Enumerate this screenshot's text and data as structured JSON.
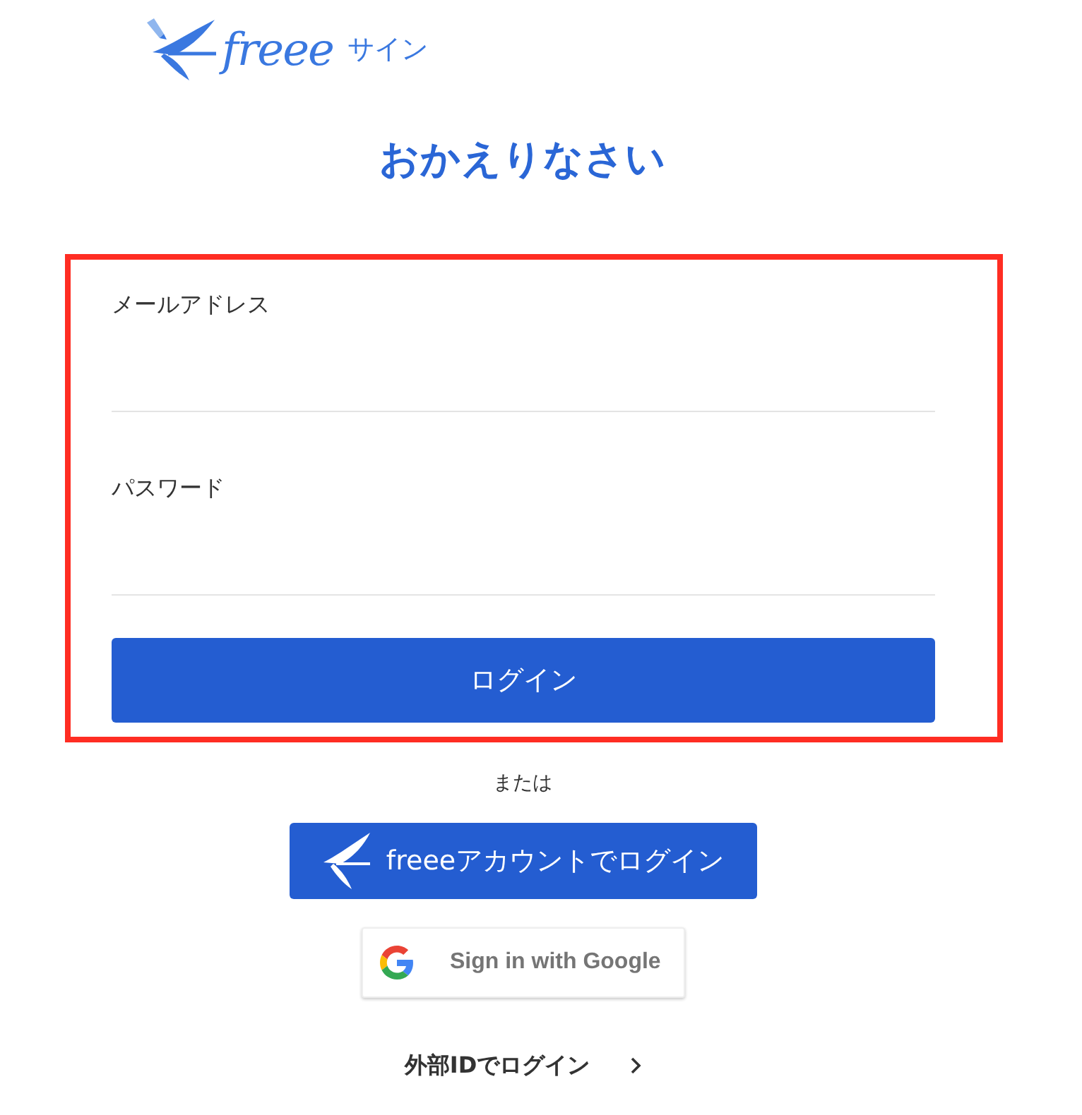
{
  "logo": {
    "wordmark": "freee",
    "product": "サイン"
  },
  "heading": "おかえりなさい",
  "form": {
    "highlighted": true,
    "fields": [
      {
        "label": "メールアドレス"
      },
      {
        "label": "パスワード"
      }
    ],
    "submit": "ログイン"
  },
  "separator": "または",
  "alt_logins": [
    {
      "kind": "freee",
      "label": "freeeアカウントでログイン"
    },
    {
      "kind": "google",
      "label": "Sign in with Google"
    }
  ],
  "external_link": {
    "label": "外部IDでログイン"
  }
}
